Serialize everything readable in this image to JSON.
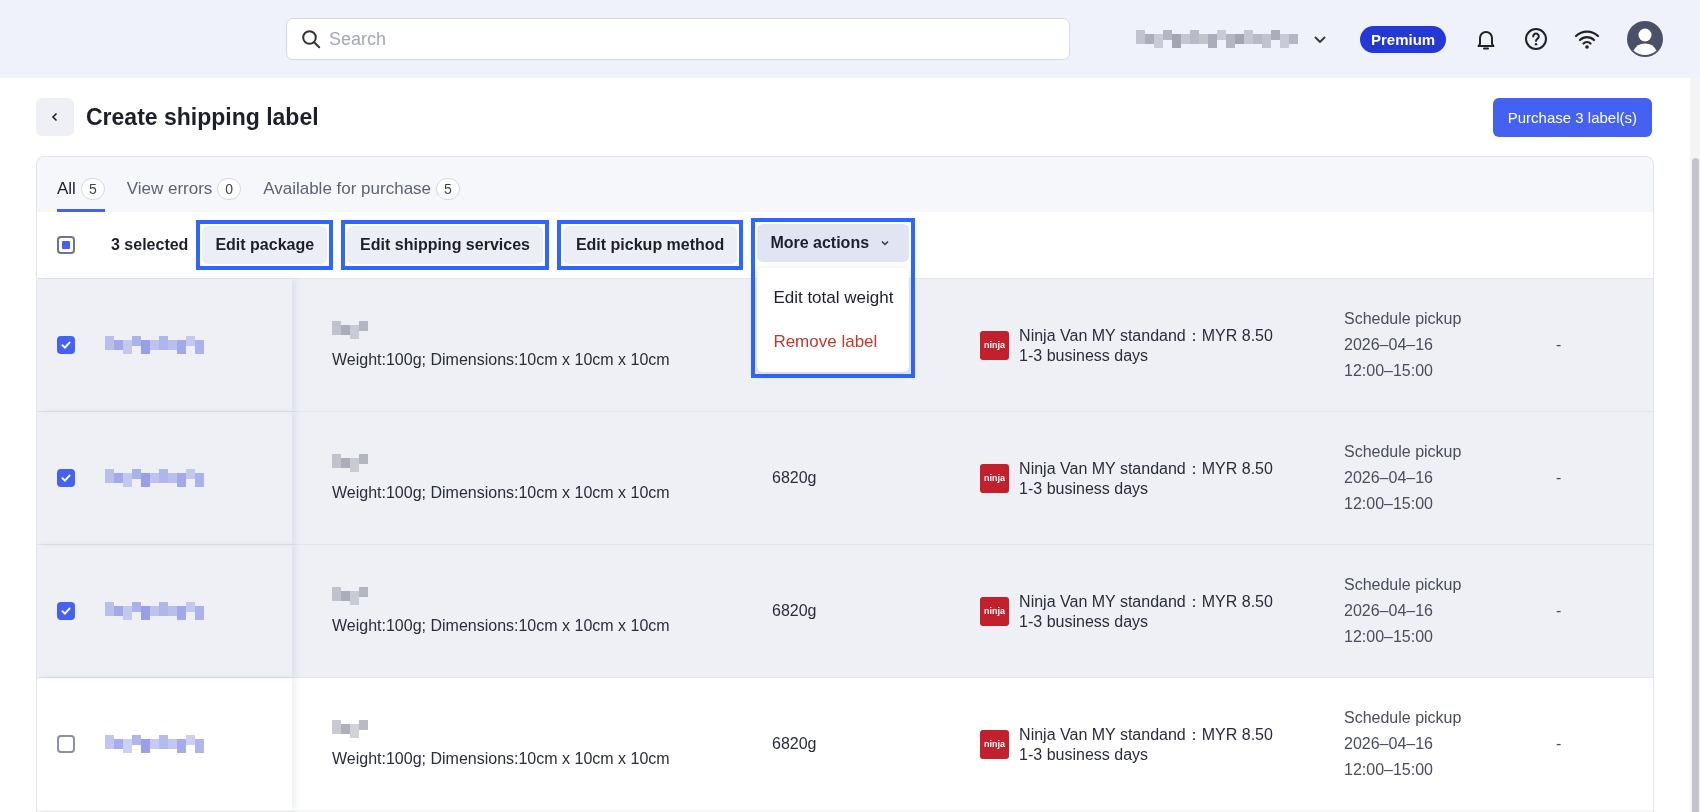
{
  "top_bar": {
    "search": {
      "placeholder": "Search"
    },
    "badge": "Premium"
  },
  "header": {
    "title": "Create shipping label",
    "primary_button": "Purchase 3 label(s)"
  },
  "tabs": [
    {
      "label": "All",
      "count": "5",
      "selected": true
    },
    {
      "label": "View errors",
      "count": "0",
      "selected": false
    },
    {
      "label": "Available for purchase",
      "count": "5",
      "selected": false
    }
  ],
  "toolbar": {
    "select_all_indeterminate": true,
    "selected_count": "3 selected",
    "actions": [
      {
        "label": "Edit package",
        "highlighted": true
      },
      {
        "label": "Edit shipping services",
        "highlighted": true
      },
      {
        "label": "Edit pickup method",
        "highlighted": true
      }
    ],
    "more_actions": {
      "label": "More actions",
      "highlighted": true,
      "expanded": true,
      "menu": [
        {
          "label": "Edit total weight",
          "kind": "normal"
        },
        {
          "label": "Remove label",
          "kind": "danger"
        }
      ]
    }
  },
  "rows": [
    {
      "selected": true,
      "package_info": "Weight:100g; Dimensions:10cm x 10cm x 10cm",
      "carrier_logo": "ninja",
      "service": "Ninja Van MY standand：MYR 8.50",
      "transit": "1-3 business days",
      "pickup_method": "Schedule pickup",
      "pickup_date": "2026–04–16",
      "pickup_time": "12:00–15:00",
      "column_6": "-"
    },
    {
      "selected": true,
      "package_info": "Weight:100g; Dimensions:10cm x 10cm x 10cm",
      "weight": "6820g",
      "carrier_logo": "ninja",
      "service": "Ninja Van MY standand：MYR 8.50",
      "transit": "1-3 business days",
      "pickup_method": "Schedule pickup",
      "pickup_date": "2026–04–16",
      "pickup_time": "12:00–15:00",
      "column_6": "-"
    },
    {
      "selected": true,
      "package_info": "Weight:100g; Dimensions:10cm x 10cm x 10cm",
      "weight": "6820g",
      "carrier_logo": "ninja",
      "service": "Ninja Van MY standand：MYR 8.50",
      "transit": "1-3 business days",
      "pickup_method": "Schedule pickup",
      "pickup_date": "2026–04–16",
      "pickup_time": "12:00–15:00",
      "column_6": "-"
    },
    {
      "selected": false,
      "package_info": "Weight:100g; Dimensions:10cm x 10cm x 10cm",
      "weight": "6820g",
      "carrier_logo": "ninja",
      "service": "Ninja Van MY standand：MYR 8.50",
      "transit": "1-3 business days",
      "pickup_method": "Schedule pickup",
      "pickup_date": "2026–04–16",
      "pickup_time": "12:00–15:00",
      "column_6": "-"
    }
  ]
}
